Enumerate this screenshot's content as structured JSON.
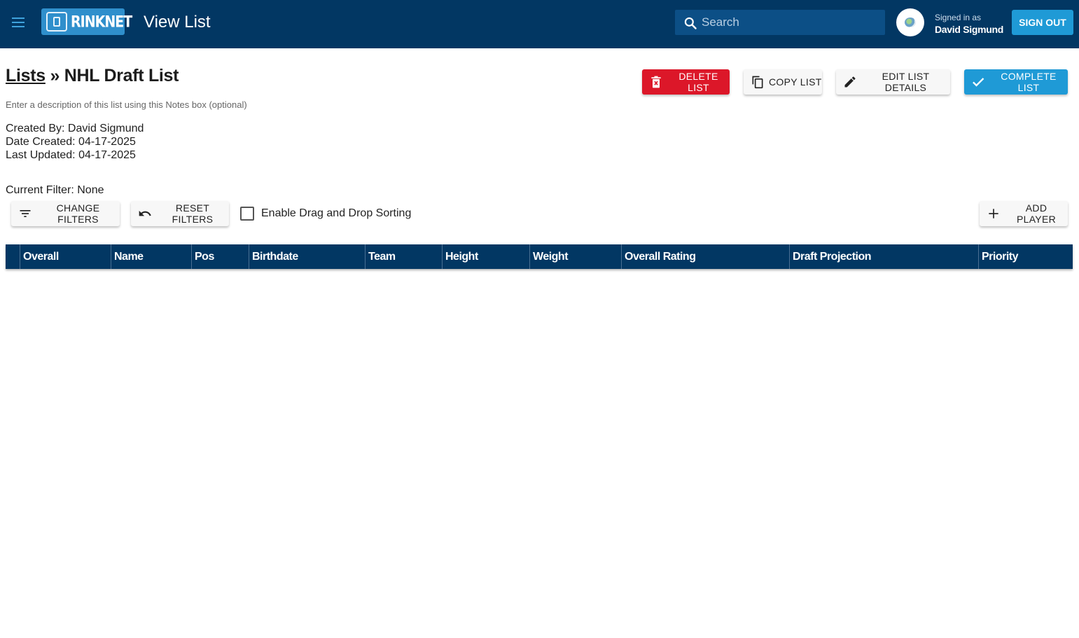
{
  "appbar": {
    "logo_text": "RINKNET",
    "title": "View List",
    "search_placeholder": "Search",
    "signed_in_label": "Signed in as",
    "user_name": "David Sigmund",
    "sign_out_label": "SIGN OUT"
  },
  "breadcrumb": {
    "parent": "Lists",
    "separator": "»",
    "current": "NHL Draft List"
  },
  "notes_hint": "Enter a description of this list using this Notes box (optional)",
  "meta": {
    "created_by": "Created By: David Sigmund",
    "date_created": "Date Created: 04-17-2025",
    "last_updated": "Last Updated: 04-17-2025"
  },
  "actions": {
    "delete": "DELETE LIST",
    "copy": "COPY LIST",
    "edit": "EDIT LIST DETAILS",
    "complete": "COMPLETE LIST"
  },
  "filters": {
    "current": "Current Filter: None",
    "change": "CHANGE FILTERS",
    "reset": "RESET FILTERS",
    "drag_drop_label": "Enable Drag and Drop Sorting",
    "drag_drop_checked": false,
    "add_player": "ADD PLAYER"
  },
  "table": {
    "columns": [
      "Overall",
      "Name",
      "Pos",
      "Birthdate",
      "Team",
      "Height",
      "Weight",
      "Overall Rating",
      "Draft Projection",
      "Priority"
    ],
    "rows": []
  },
  "colors": {
    "appbar": "#023763",
    "accent": "#1f9ad6",
    "danger": "#dc1729"
  },
  "icons": [
    "menu-icon",
    "search-icon",
    "delete-icon",
    "copy-icon",
    "edit-icon",
    "check-icon",
    "filter-icon",
    "undo-icon",
    "plus-icon"
  ]
}
